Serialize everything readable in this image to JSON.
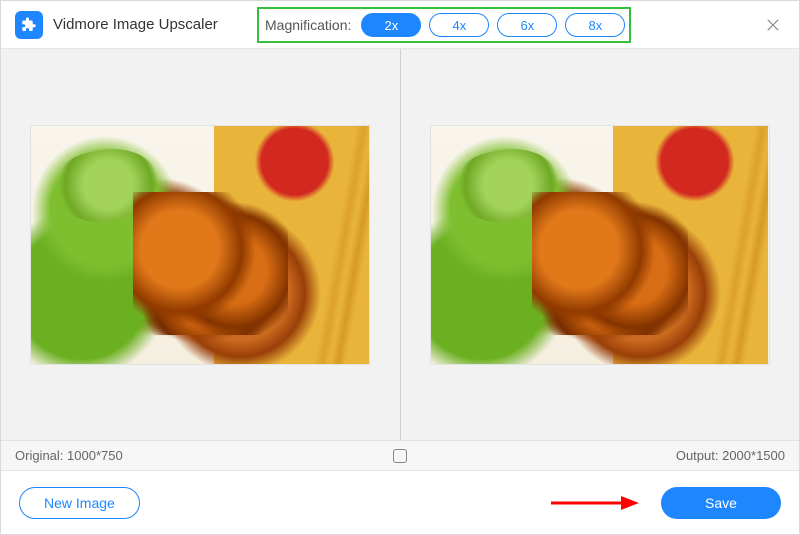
{
  "header": {
    "app_title": "Vidmore Image Upscaler",
    "magnification_label": "Magnification:",
    "options": [
      "2x",
      "4x",
      "6x",
      "8x"
    ],
    "selected_option": "2x"
  },
  "info": {
    "original_label": "Original: 1000*750",
    "output_label": "Output: 2000*1500"
  },
  "footer": {
    "new_image_label": "New Image",
    "save_label": "Save"
  },
  "colors": {
    "accent": "#1e87ff",
    "highlight_border": "#34c03b",
    "arrow": "#ff0000"
  }
}
